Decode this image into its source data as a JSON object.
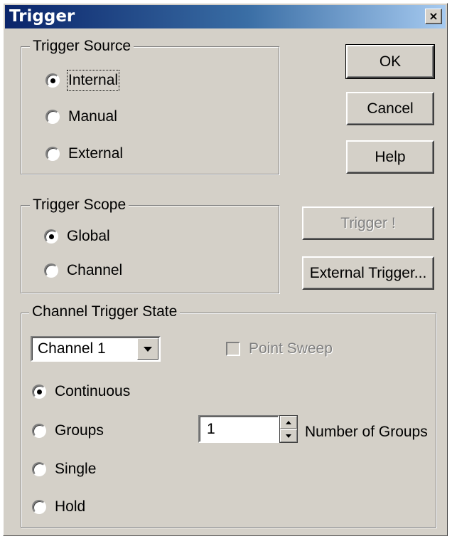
{
  "window": {
    "title": "Trigger",
    "close_glyph": "×"
  },
  "trigger_source": {
    "legend": "Trigger Source",
    "options": [
      {
        "label": "Internal",
        "checked": true
      },
      {
        "label": "Manual",
        "checked": false
      },
      {
        "label": "External",
        "checked": false
      }
    ]
  },
  "trigger_scope": {
    "legend": "Trigger Scope",
    "options": [
      {
        "label": "Global",
        "checked": true
      },
      {
        "label": "Channel",
        "checked": false
      }
    ]
  },
  "buttons": {
    "ok": "OK",
    "cancel": "Cancel",
    "help": "Help",
    "trigger": "Trigger !",
    "external_trigger": "External Trigger..."
  },
  "channel_trigger_state": {
    "legend": "Channel Trigger State",
    "channel_select": "Channel 1",
    "point_sweep": {
      "label": "Point Sweep",
      "checked": false,
      "enabled": false
    },
    "modes": [
      {
        "label": "Continuous",
        "checked": true
      },
      {
        "label": "Groups",
        "checked": false
      },
      {
        "label": "Single",
        "checked": false
      },
      {
        "label": "Hold",
        "checked": false
      }
    ],
    "number_of_groups": {
      "value": "1",
      "label": "Number of Groups"
    }
  },
  "colors": {
    "dialog_bg": "#d4d0c8",
    "title_start": "#0a246a",
    "title_end": "#a6caf0",
    "disabled_text": "#808080"
  }
}
